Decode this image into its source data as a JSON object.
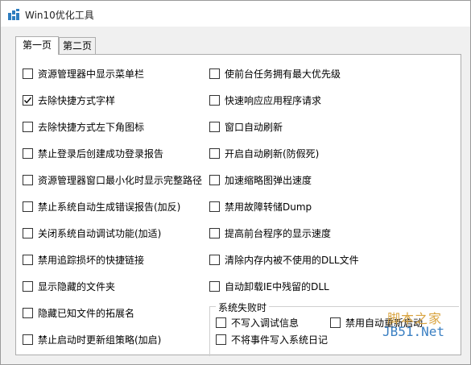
{
  "window": {
    "title": "Win10优化工具"
  },
  "tabs": [
    {
      "label": "第一页",
      "active": true
    },
    {
      "label": "第二页",
      "active": false
    }
  ],
  "left_options": [
    {
      "label": "资源管理器中显示菜单栏",
      "checked": false
    },
    {
      "label": "去除快捷方式字样",
      "checked": true
    },
    {
      "label": "去除快捷方式左下角图标",
      "checked": false
    },
    {
      "label": "禁止登录后创建成功登录报告",
      "checked": false
    },
    {
      "label": "资源管理器窗口最小化时显示完整路径",
      "checked": false
    },
    {
      "label": "禁止系统自动生成错误报告(加反)",
      "checked": false
    },
    {
      "label": "关闭系统自动调试功能(加适)",
      "checked": false
    },
    {
      "label": "禁用追踪损坏的快捷链接",
      "checked": false
    },
    {
      "label": "显示隐藏的文件夹",
      "checked": false
    },
    {
      "label": "隐藏已知文件的拓展名",
      "checked": false
    },
    {
      "label": "禁止启动时更新组策略(加启)",
      "checked": false
    }
  ],
  "right_options": [
    {
      "label": "使前台任务拥有最大优先级",
      "checked": false
    },
    {
      "label": "快速响应应用程序请求",
      "checked": false
    },
    {
      "label": "窗口自动刷新",
      "checked": false
    },
    {
      "label": "开启自动刷新(防假死)",
      "checked": false
    },
    {
      "label": "加速缩略图弹出速度",
      "checked": false
    },
    {
      "label": "禁用故障转储Dump",
      "checked": false
    },
    {
      "label": "提高前台程序的显示速度",
      "checked": false
    },
    {
      "label": "清除内存内被不使用的DLL文件",
      "checked": false
    },
    {
      "label": "自动卸载IE中残留的DLL",
      "checked": false
    }
  ],
  "failure_group": {
    "title": "系统失败时",
    "options": [
      {
        "label": "不写入调试信息",
        "checked": false
      },
      {
        "label": "禁用自动重新启动",
        "checked": false
      },
      {
        "label": "不将事件写入系统日记",
        "checked": false
      }
    ]
  },
  "watermark": {
    "cn": "脚本之家",
    "en": "JB51.Net"
  },
  "colors": {
    "watermark_cn": "#d9a441",
    "watermark_en": "#3a7fc2",
    "app_icon": "#2e7dbf"
  }
}
